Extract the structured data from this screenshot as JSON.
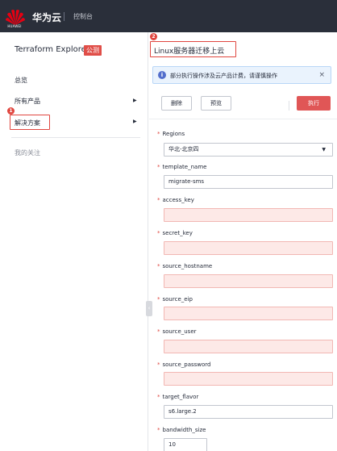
{
  "header": {
    "logo_text": "HUAWEI",
    "brand": "华为云",
    "console": "控制台"
  },
  "sidebar": {
    "title": "Terraform Explorer",
    "badge": "公测",
    "items": [
      {
        "label": "总览"
      },
      {
        "label": "所有产品"
      },
      {
        "label": "解决方案"
      },
      {
        "label": "我的关注"
      }
    ]
  },
  "annotations": {
    "marker1": "1",
    "marker2": "2"
  },
  "main": {
    "title": "Linux服务器迁移上云",
    "info": "部分执行操作涉及云产品计费，请谨慎操作",
    "info_icon": "i",
    "close": "×",
    "buttons": {
      "delete": "删除",
      "preview": "预览",
      "execute": "执行"
    },
    "fields": [
      {
        "label": "Regions",
        "value": "华北-北京四",
        "type": "select"
      },
      {
        "label": "template_name",
        "value": "migrate-sms",
        "type": "text"
      },
      {
        "label": "access_key",
        "value": "",
        "type": "error"
      },
      {
        "label": "secret_key",
        "value": "",
        "type": "error"
      },
      {
        "label": "source_hostname",
        "value": "",
        "type": "error"
      },
      {
        "label": "source_eip",
        "value": "",
        "type": "error"
      },
      {
        "label": "source_user",
        "value": "",
        "type": "error"
      },
      {
        "label": "source_password",
        "value": "",
        "type": "error"
      },
      {
        "label": "target_flavor",
        "value": "s6.large.2",
        "type": "text"
      },
      {
        "label": "bandwidth_size",
        "value": "10",
        "type": "text"
      }
    ],
    "required_mark": "*"
  },
  "colors": {
    "topbar": "#2a2f3a",
    "accent_red": "#e0463f",
    "error_fill": "#fde9e7",
    "info_bg": "#eaf3fd"
  }
}
